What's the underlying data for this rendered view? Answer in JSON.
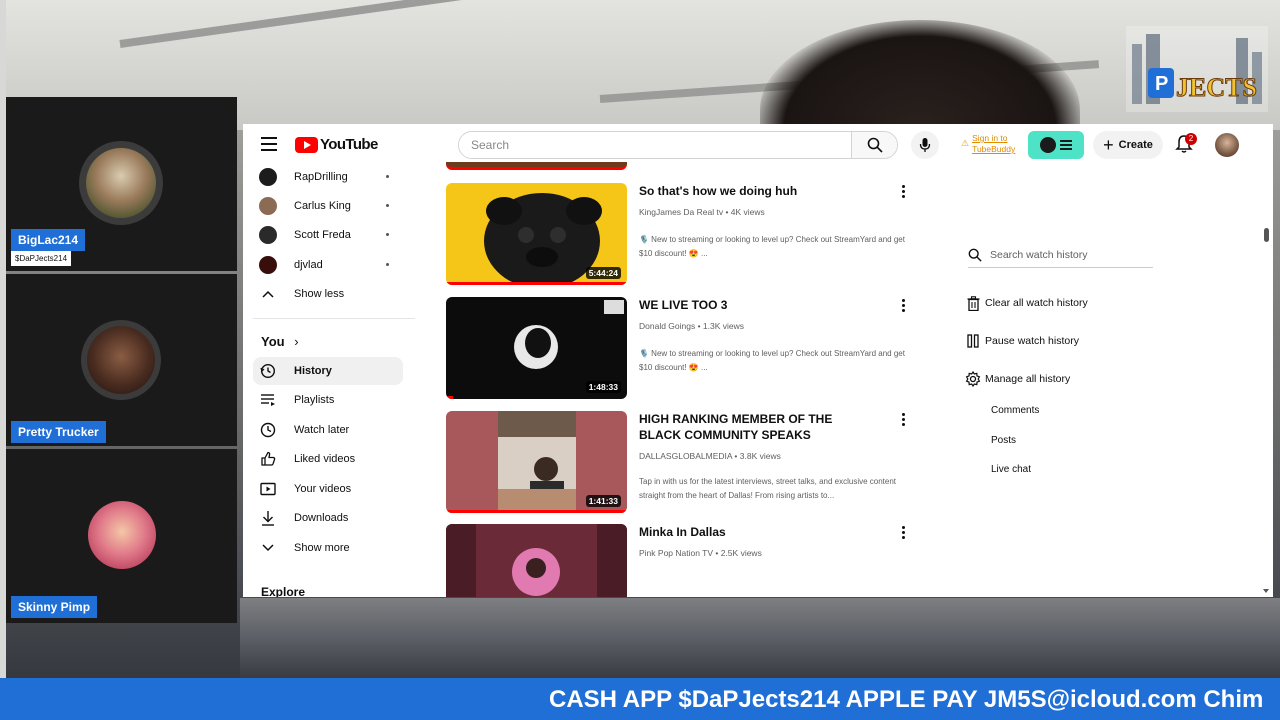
{
  "cams": [
    {
      "name": "BigLac214",
      "sub": "$DaPJects214"
    },
    {
      "name": "Pretty Trucker"
    },
    {
      "name": "Skinny Pimp"
    }
  ],
  "logo_text": "JECTS",
  "ticker": "CASH APP $DaPJects214 APPLE PAY JM5S@icloud.com Chim",
  "youtube": {
    "logo_word": "YouTube",
    "search_placeholder": "Search",
    "tubebuddy_line1": "Sign in to",
    "tubebuddy_line2": "TubeBuddy",
    "create_label": "Create",
    "notif_count": "2",
    "accent": "#ff0000",
    "sidebar": {
      "subscriptions": [
        {
          "label": "RapDrilling",
          "color": "#1c1c1c"
        },
        {
          "label": "Carlus King",
          "color": "#8c6b55"
        },
        {
          "label": "Scott Freda",
          "color": "#2a2a2a"
        },
        {
          "label": "djvlad",
          "color": "#3a0d0d"
        }
      ],
      "show_less": "Show less",
      "you_label": "You",
      "you_items": [
        {
          "label": "History",
          "icon": "history-icon",
          "active": true
        },
        {
          "label": "Playlists",
          "icon": "playlists-icon"
        },
        {
          "label": "Watch later",
          "icon": "watch-later-icon"
        },
        {
          "label": "Liked videos",
          "icon": "thumbs-up-icon"
        },
        {
          "label": "Your videos",
          "icon": "your-videos-icon"
        },
        {
          "label": "Downloads",
          "icon": "download-icon"
        },
        {
          "label": "Show more",
          "icon": "chevron-down-icon"
        }
      ],
      "explore_label": "Explore"
    },
    "videos": [
      {
        "title": "So that's how we doing huh",
        "meta": "KingJames Da Real tv • 4K views",
        "desc": "🎙️ New to streaming or looking to level up? Check out StreamYard and get $10 discount! 😍 ...",
        "duration": "5:44:24"
      },
      {
        "title": "WE LIVE TOO 3",
        "meta": "Donald Goings • 1.3K views",
        "desc": "🎙️ New to streaming or looking to level up? Check out StreamYard and get $10 discount! 😍 ...",
        "duration": "1:48:33"
      },
      {
        "title": "HIGH RANKING MEMBER OF THE BLACK COMMUNITY SPEAKS",
        "meta": "DALLASGLOBALMEDIA • 3.8K views",
        "desc": "Tap in with us for the latest interviews, street talks, and exclusive content straight from the heart of Dallas! From rising artists to...",
        "duration": "1:41:33"
      },
      {
        "title": "Minka In Dallas",
        "meta": "Pink Pop Nation TV • 2.5K views",
        "desc": "",
        "duration": ""
      }
    ],
    "history_panel": {
      "search_placeholder": "Search watch history",
      "clear": "Clear all watch history",
      "pause": "Pause watch history",
      "manage": "Manage all history",
      "subs": [
        "Comments",
        "Posts",
        "Live chat"
      ]
    }
  }
}
